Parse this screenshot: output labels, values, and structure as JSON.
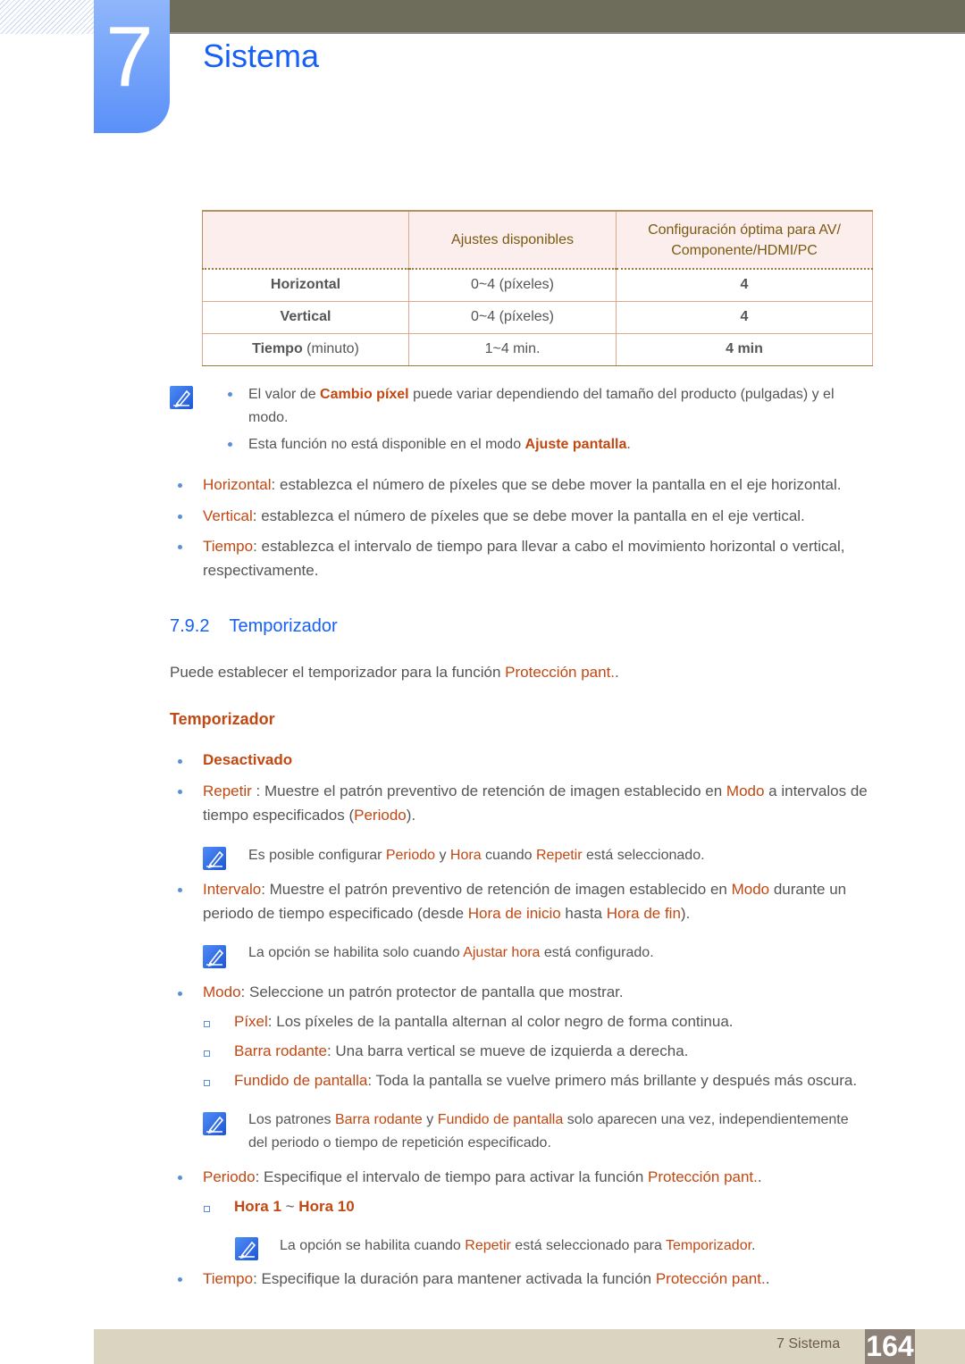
{
  "header": {
    "chapter_number": "7",
    "chapter_title": "Sistema"
  },
  "table": {
    "headers": [
      "",
      "Ajustes disponibles",
      "Configuración óptima para AV/\nComponente/HDMI/PC"
    ],
    "header_line1": "Configuración óptima para AV/",
    "header_line2": "Componente/HDMI/PC",
    "rows": [
      {
        "label": "Horizontal",
        "unit": "",
        "range": "0~4 (píxeles)",
        "optimal": "4"
      },
      {
        "label": "Vertical",
        "unit": "",
        "range": "0~4 (píxeles)",
        "optimal": "4"
      },
      {
        "label": "Tiempo",
        "unit": " (minuto)",
        "range": "1~4 min.",
        "optimal": "4 min"
      }
    ]
  },
  "note1": {
    "items": [
      {
        "pre": "El valor de ",
        "hl": "Cambio píxel",
        "post": " puede variar dependiendo del tamaño del producto (pulgadas) y el",
        "line2": "modo."
      },
      {
        "pre": "Esta función no está disponible en el modo ",
        "hl": "Ajuste pantalla",
        "post": "."
      }
    ]
  },
  "bullets1": [
    {
      "hl": "Horizontal",
      "text": ": establezca el número de píxeles que se debe mover la pantalla en el eje horizontal."
    },
    {
      "hl": "Vertical",
      "text": ": establezca el número de píxeles que se debe mover la pantalla en el eje vertical."
    },
    {
      "hl": "Tiempo",
      "text": ": establezca el intervalo de tiempo para llevar a cabo el movimiento horizontal o vertical,",
      "line2": "respectivamente."
    }
  ],
  "section": {
    "number": "7.9.2",
    "title": "Temporizador",
    "intro_pre": "Puede establecer el temporizador para la función ",
    "intro_hl": "Protección pant.",
    "intro_post": ".",
    "subheading": "Temporizador"
  },
  "timer_options": {
    "desactivado": "Desactivado",
    "repetir": {
      "hl": "Repetir",
      "t1": " : Muestre el patrón preventivo de retención de imagen establecido en ",
      "hl2": "Modo",
      "t2": " a intervalos de",
      "line2_pre": "tiempo especificados (",
      "line2_hl": "Periodo",
      "line2_post": ")."
    },
    "repetir_note": {
      "t1": "Es posible configurar ",
      "h1": "Periodo",
      "t2": " y ",
      "h2": "Hora",
      "t3": " cuando ",
      "h3": "Repetir",
      "t4": " está seleccionado."
    },
    "intervalo": {
      "hl": "Intervalo",
      "t1": ": Muestre el patrón preventivo de retención de imagen establecido en ",
      "hl2": "Modo",
      "t2": " durante un",
      "line2_pre": "periodo de tiempo especificado (desde ",
      "line2_h1": "Hora de inicio",
      "line2_mid": " hasta ",
      "line2_h2": "Hora de fin",
      "line2_post": ")."
    },
    "intervalo_note": {
      "t1": "La opción se habilita solo cuando ",
      "h1": "Ajustar hora",
      "t2": " está configurado."
    },
    "modo": {
      "hl": "Modo",
      "text": ": Seleccione un patrón protector de pantalla que mostrar."
    },
    "modo_sub": [
      {
        "hl": "Píxel",
        "text": ": Los píxeles de la pantalla alternan al color negro de forma continua."
      },
      {
        "hl": "Barra rodante",
        "text": ": Una barra vertical se mueve de izquierda a derecha."
      },
      {
        "hl": "Fundido de pantalla",
        "text": ": Toda la pantalla se vuelve primero más brillante y después más oscura."
      }
    ],
    "modo_note": {
      "t1": "Los patrones ",
      "h1": "Barra rodante",
      "t2": " y ",
      "h2": "Fundido de pantalla",
      "t3": " solo aparecen una vez, independientemente",
      "line2": "del periodo o tiempo de repetición especificado."
    },
    "periodo": {
      "hl": "Periodo",
      "text": ": Especifique el intervalo de tiempo para activar la función ",
      "hl2": "Protección pant.",
      "post": "."
    },
    "periodo_sub": {
      "h1": "Hora 1",
      "mid": " ~ ",
      "h2": "Hora 10"
    },
    "periodo_note": {
      "t1": "La opción se habilita cuando ",
      "h1": "Repetir",
      "t2": " está seleccionado para ",
      "h2": "Temporizador",
      "t3": "."
    },
    "tiempo": {
      "hl": "Tiempo",
      "text": ": Especifique la duración para mantener activada la función ",
      "hl2": "Protección pant.",
      "post": "."
    }
  },
  "footer": {
    "label": "7 Sistema",
    "page": "164"
  },
  "colors": {
    "accent_blue": "#1660f5",
    "highlight_orange": "#c24812",
    "topbar": "#6e6c5a",
    "footer_bg": "#dbd4c0",
    "page_box": "#8e8178"
  }
}
